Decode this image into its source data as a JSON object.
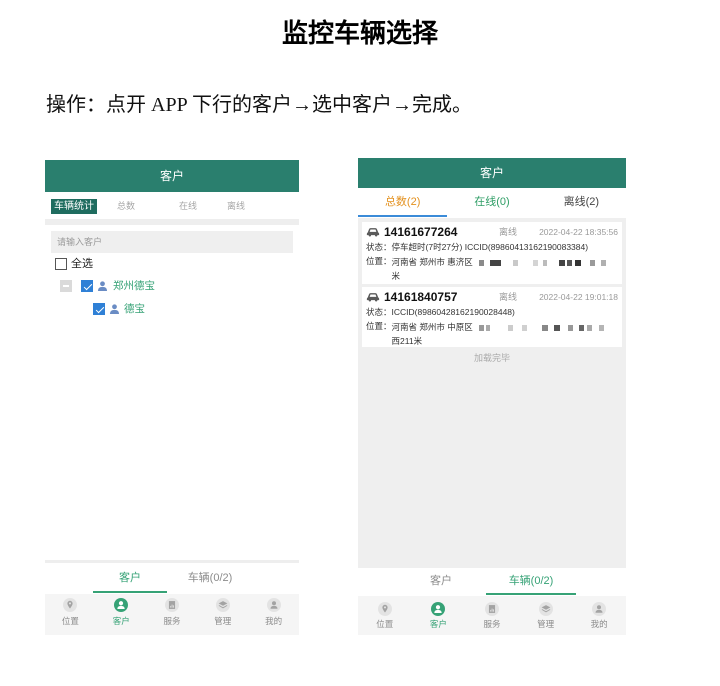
{
  "document": {
    "title": "监控车辆选择",
    "instruction": "操作：点开 APP 下行的客户→选中客户→完成。"
  },
  "colors": {
    "header_teal": "#2a7f6e",
    "stat_active_bg": "#1f6c5f",
    "accent_green": "#36a276",
    "check_blue": "#2f80d6",
    "total_orange": "#e3911f",
    "online_green": "#2f9e66",
    "offline_gray": "#444444",
    "filter_underline": "#3b8bd8",
    "person_blue": "#6a8cc4"
  },
  "left_screen": {
    "header_title": "客户",
    "stat_tabs": [
      {
        "label": "车辆统计",
        "active": true
      },
      {
        "label": "总数",
        "active": false
      },
      {
        "label": "在线",
        "active": false
      },
      {
        "label": "离线",
        "active": false
      }
    ],
    "search_placeholder": "请输入客户",
    "select_all": {
      "label": "全选",
      "checked": false
    },
    "tree": [
      {
        "label": "郑州德宝",
        "checked": true,
        "expanded": true,
        "icon": "user-icon"
      },
      {
        "label": "德宝",
        "checked": true,
        "icon": "user-icon"
      }
    ],
    "bottom_tabs": [
      {
        "label": "客户",
        "active": true
      },
      {
        "label": "车辆(0/2)",
        "active": false
      }
    ],
    "nav": [
      {
        "label": "位置",
        "icon": "location-icon",
        "active": false
      },
      {
        "label": "客户",
        "icon": "user-icon",
        "active": true
      },
      {
        "label": "服务",
        "icon": "service-icon",
        "active": false
      },
      {
        "label": "管理",
        "icon": "manage-icon",
        "active": false
      },
      {
        "label": "我的",
        "icon": "profile-icon",
        "active": false
      }
    ]
  },
  "right_screen": {
    "header_title": "客户",
    "filter_tabs": [
      {
        "label": "总数(2)",
        "active": true
      },
      {
        "label": "在线(0)",
        "active": false
      },
      {
        "label": "离线(2)",
        "active": false
      }
    ],
    "vehicles": [
      {
        "id": "14161677264",
        "status": "离线",
        "time": "2022-04-22 18:35:56",
        "state_label": "状态：",
        "state": "停车超时(7时27分) ICCID(89860413162190083384)",
        "location_label": "位置：",
        "location": "河南省 郑州市 惠济区",
        "location_tail": "米",
        "icon": "car-icon"
      },
      {
        "id": "14161840757",
        "status": "离线",
        "time": "2022-04-22 19:01:18",
        "state_label": "状态：",
        "state": "ICCID(89860428162190028448)",
        "location_label": "位置：",
        "location": "河南省 郑州市 中原区",
        "location_tail": "西211米",
        "icon": "car-icon"
      }
    ],
    "load_done": "加载完毕",
    "bottom_tabs": [
      {
        "label": "客户",
        "active": false
      },
      {
        "label": "车辆(0/2)",
        "active": true
      }
    ],
    "nav": [
      {
        "label": "位置",
        "icon": "location-icon",
        "active": false
      },
      {
        "label": "客户",
        "icon": "user-icon",
        "active": true
      },
      {
        "label": "服务",
        "icon": "service-icon",
        "active": false
      },
      {
        "label": "管理",
        "icon": "manage-icon",
        "active": false
      },
      {
        "label": "我的",
        "icon": "profile-icon",
        "active": false
      }
    ]
  }
}
